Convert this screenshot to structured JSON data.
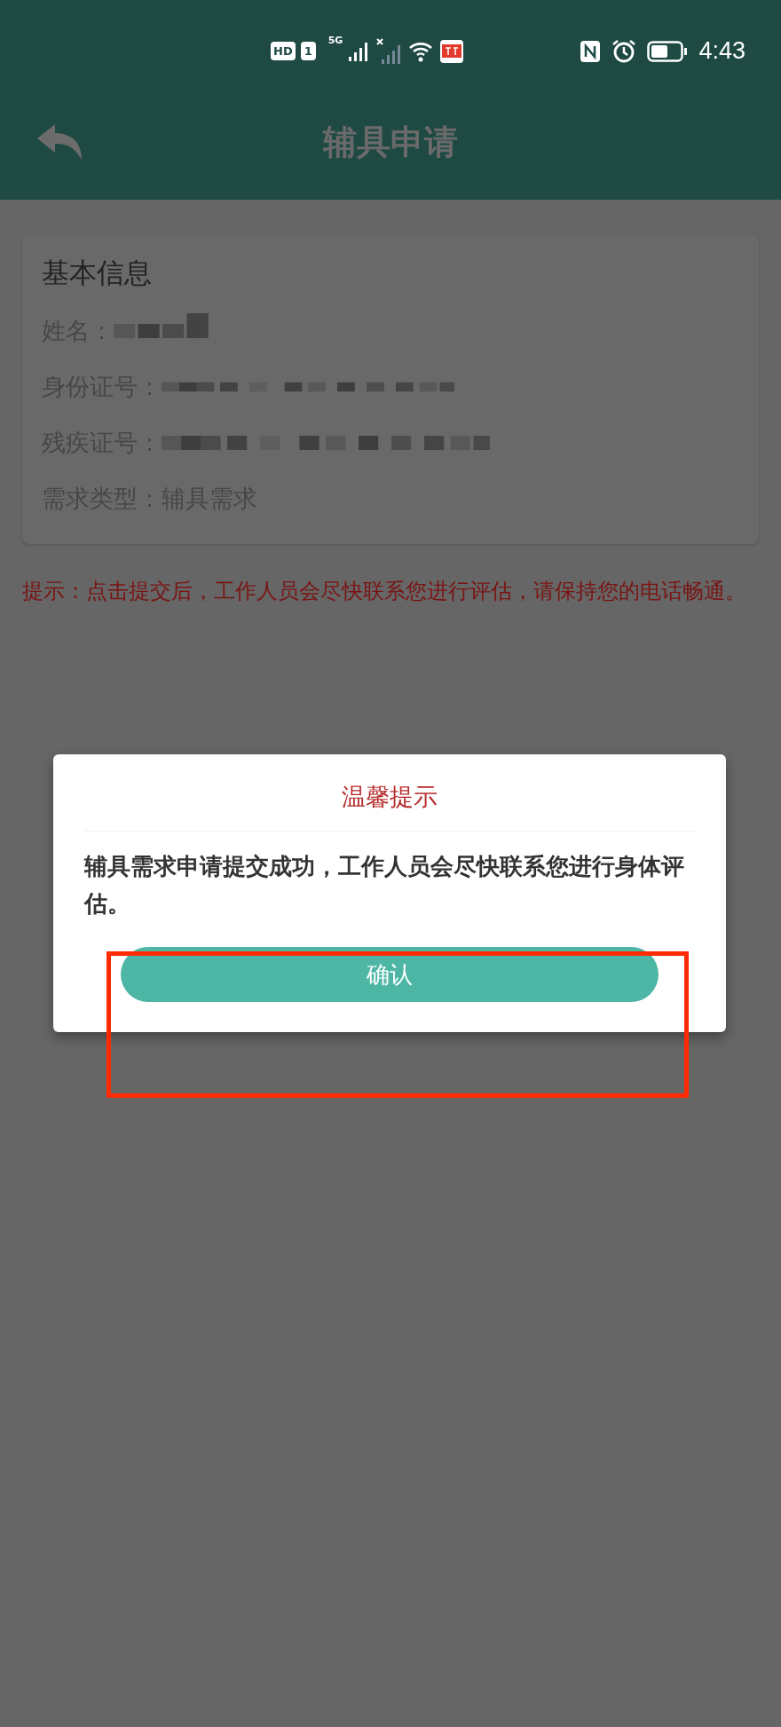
{
  "status_bar": {
    "hd_badge": "HD",
    "sim": "1",
    "network": "5G",
    "time": "4:43"
  },
  "header": {
    "title": "辅具申请"
  },
  "card": {
    "title": "基本信息",
    "fields": [
      {
        "label": "姓名：",
        "kind": "redacted"
      },
      {
        "label": "身份证号：",
        "kind": "redacted"
      },
      {
        "label": "残疾证号：",
        "kind": "redacted"
      },
      {
        "label": "需求类型：",
        "kind": "text",
        "value": "辅具需求"
      }
    ]
  },
  "hint": "提示：点击提交后，工作人员会尽快联系您进行评估，请保持您的电话畅通。",
  "dialog": {
    "title": "温馨提示",
    "message": "辅具需求申请提交成功，工作人员会尽快联系您进行身体评估。",
    "button": "确认"
  },
  "annotation": {
    "highlight": true
  }
}
